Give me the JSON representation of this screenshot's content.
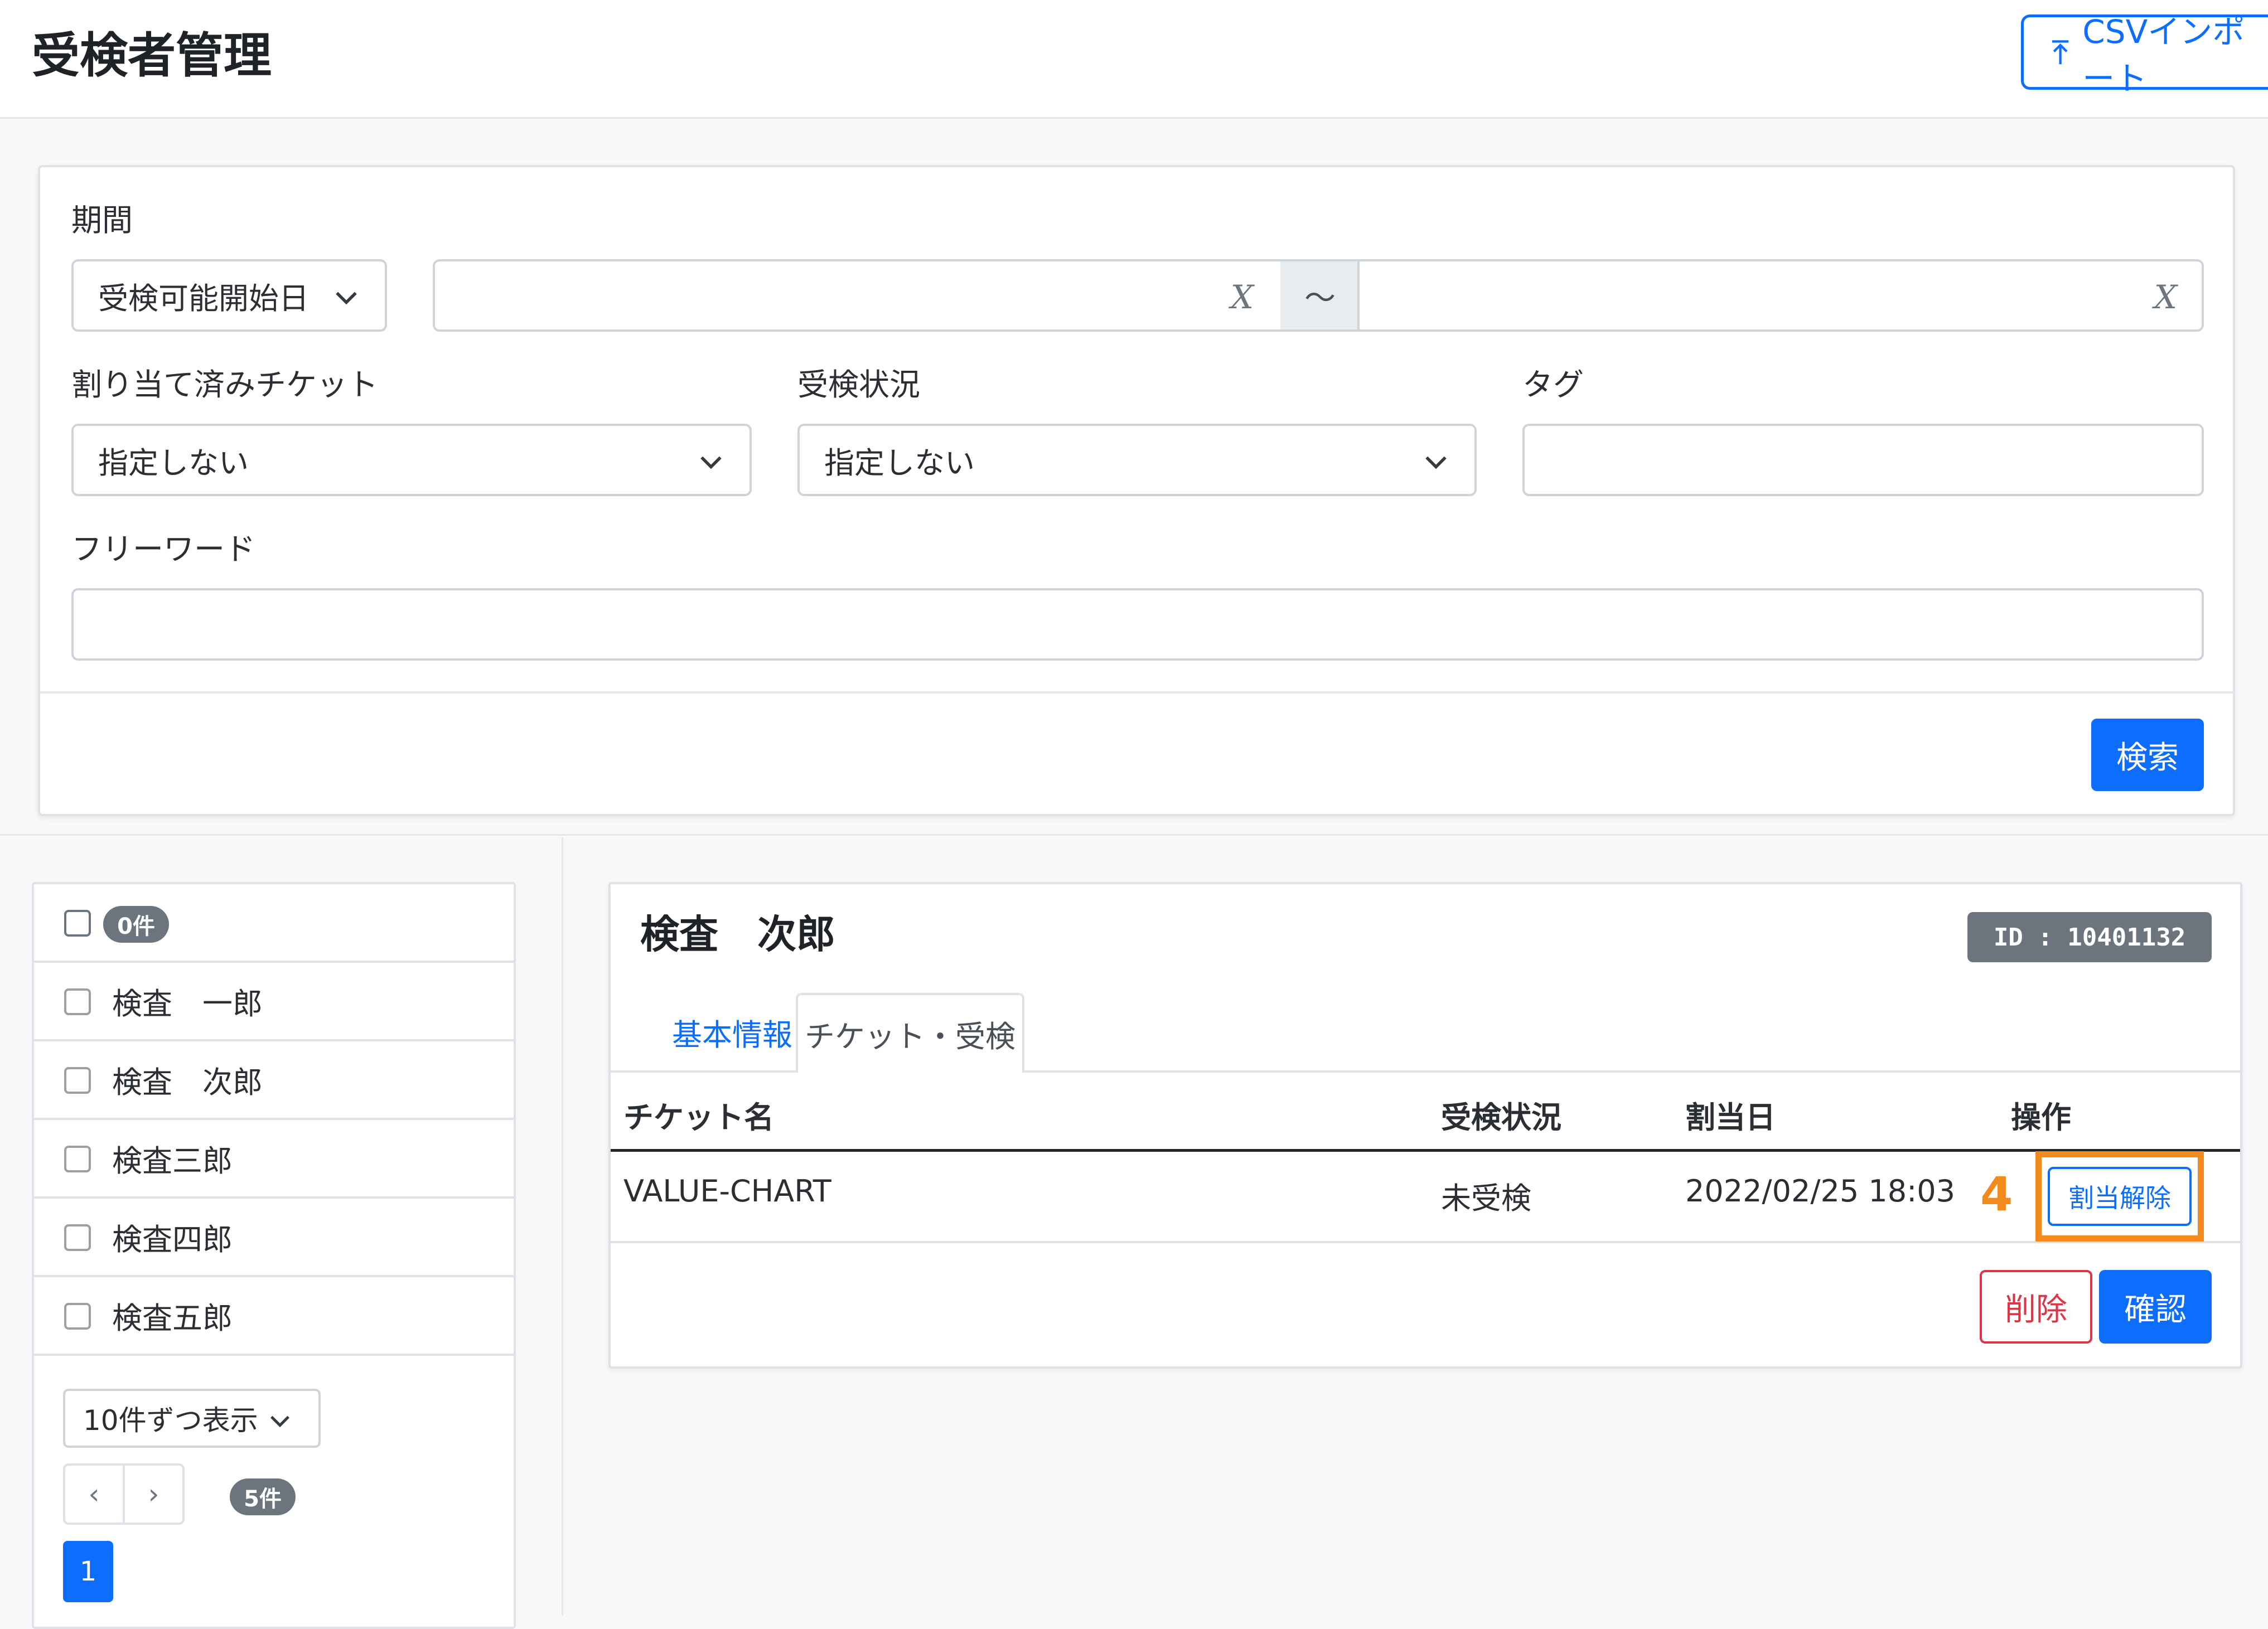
{
  "header": {
    "title": "受検者管理",
    "import_label": "CSVインポート"
  },
  "search": {
    "period_label": "期間",
    "period_type": "受検可能開始日",
    "date_from": "",
    "date_to": "",
    "date_clear": "X",
    "tilde": "～",
    "ticket_label": "割り当て済みチケット",
    "ticket_value": "指定しない",
    "status_label": "受検状況",
    "status_value": "指定しない",
    "tag_label": "タグ",
    "tag_value": "",
    "freeword_label": "フリーワード",
    "freeword_value": "",
    "search_button": "検索"
  },
  "list": {
    "selected_count": "0件",
    "items": [
      {
        "name": "検査　一郎"
      },
      {
        "name": "検査　次郎"
      },
      {
        "name": "検査三郎"
      },
      {
        "name": "検査四郎"
      },
      {
        "name": "検査五郎"
      }
    ],
    "per_page": "10件ずつ表示",
    "prev": "‹",
    "next": "›",
    "total": "5件",
    "current_page": "1"
  },
  "detail": {
    "name": "検査　次郎",
    "id_label": "ID : 10401132",
    "tabs": [
      {
        "label": "基本情報"
      },
      {
        "label": "チケット・受検"
      }
    ],
    "columns": [
      "チケット名",
      "受検状況",
      "割当日",
      "操作"
    ],
    "rows": [
      {
        "ticket": "VALUE-CHART",
        "status": "未受検",
        "assigned_at": "2022/02/25 18:03",
        "action": "割当解除"
      }
    ],
    "step_number": "4",
    "delete_button": "削除",
    "confirm_button": "確認"
  },
  "colors": {
    "primary": "#0d6efd",
    "danger": "#dc3545",
    "highlight": "#f28a1e",
    "badge": "#6c757d"
  }
}
